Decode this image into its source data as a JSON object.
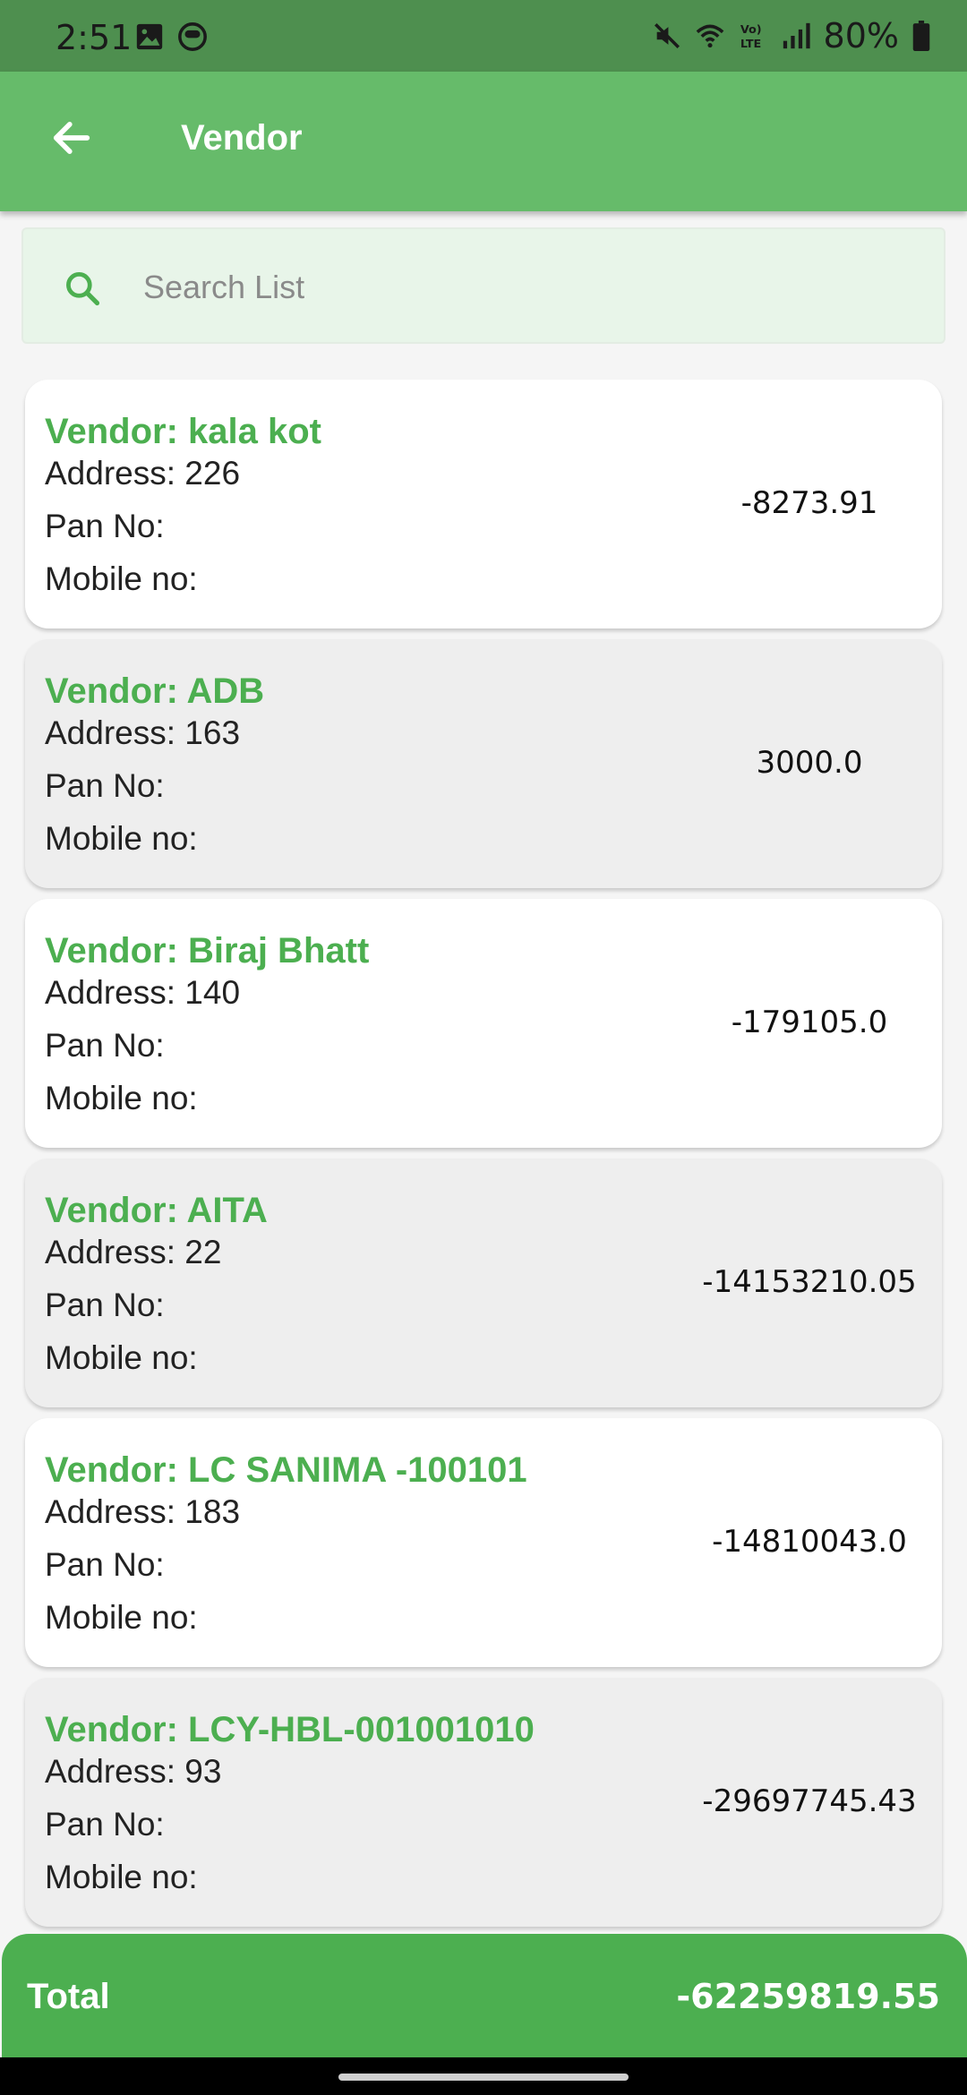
{
  "status_bar": {
    "time": "2:51",
    "battery": "80%",
    "icons": [
      "image-icon",
      "face-icon",
      "mute-icon",
      "wifi-icon",
      "volte-icon",
      "signal-icon",
      "battery-icon"
    ]
  },
  "app_bar": {
    "title": "Vendor",
    "back_icon": "arrow-left-icon"
  },
  "search": {
    "placeholder": "Search List",
    "value": ""
  },
  "vendors": [
    {
      "name": "Vendor: kala kot",
      "address": "Address: 226",
      "pan": "Pan No:",
      "mobile": "Mobile no:",
      "amount": "-8273.91"
    },
    {
      "name": "Vendor: ADB",
      "address": "Address: 163",
      "pan": "Pan No:",
      "mobile": "Mobile no:",
      "amount": "3000.0"
    },
    {
      "name": "Vendor: Biraj Bhatt",
      "address": "Address: 140",
      "pan": "Pan No:",
      "mobile": "Mobile no:",
      "amount": "-179105.0"
    },
    {
      "name": "Vendor: AITA",
      "address": "Address: 22",
      "pan": "Pan No:",
      "mobile": "Mobile no:",
      "amount": "-14153210.05"
    },
    {
      "name": "Vendor: LC SANIMA -100101",
      "address": "Address: 183",
      "pan": "Pan No:",
      "mobile": "Mobile no:",
      "amount": "-14810043.0"
    },
    {
      "name": "Vendor: LCY-HBL-001001010",
      "address": "Address: 93",
      "pan": "Pan No:",
      "mobile": "Mobile no:",
      "amount": "-29697745.43"
    }
  ],
  "total": {
    "label": "Total",
    "value": "-62259819.55"
  },
  "colors": {
    "status_bar": "#4e8f4f",
    "app_bar": "#66bb6a",
    "accent": "#4caf50",
    "search_bg": "#e8f5e9"
  }
}
